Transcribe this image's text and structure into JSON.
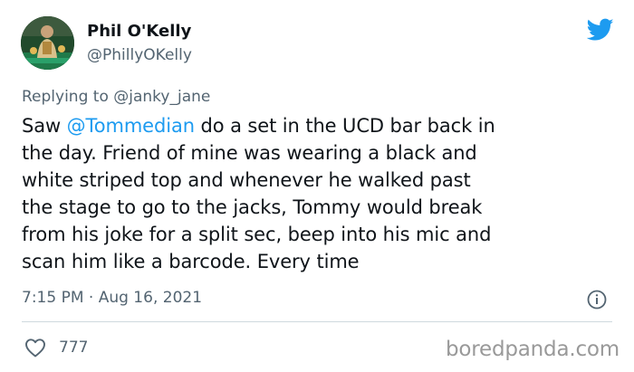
{
  "author": {
    "name": "Phil O'Kelly",
    "handle": "@PhillyOKelly"
  },
  "reply": {
    "prefix": "Replying to",
    "target": "@janky_jane"
  },
  "tweet": {
    "lines": [
      {
        "pre": "Saw ",
        "link": "@Tommedian",
        "post": " do a set in the UCD bar back in"
      },
      {
        "text": "the day. Friend of mine was wearing a black and"
      },
      {
        "text": "white striped top and whenever he walked past"
      },
      {
        "text": "the stage to go to the jacks, Tommy would break"
      },
      {
        "text": "from his joke for a split sec, beep into his mic and"
      },
      {
        "text": "scan him like a barcode. Every time"
      }
    ]
  },
  "timestamp": "7:15 PM · Aug 16, 2021",
  "likes": {
    "count": "777"
  },
  "watermark": "boredpanda.com",
  "colors": {
    "link": "#1d9bf0",
    "muted": "#536471",
    "text": "#0f1419",
    "twitter_blue": "#1d9bf0",
    "watermark": "#999999"
  },
  "icons": {
    "brand": "twitter-bird-icon",
    "info": "info-icon",
    "like": "heart-icon"
  }
}
